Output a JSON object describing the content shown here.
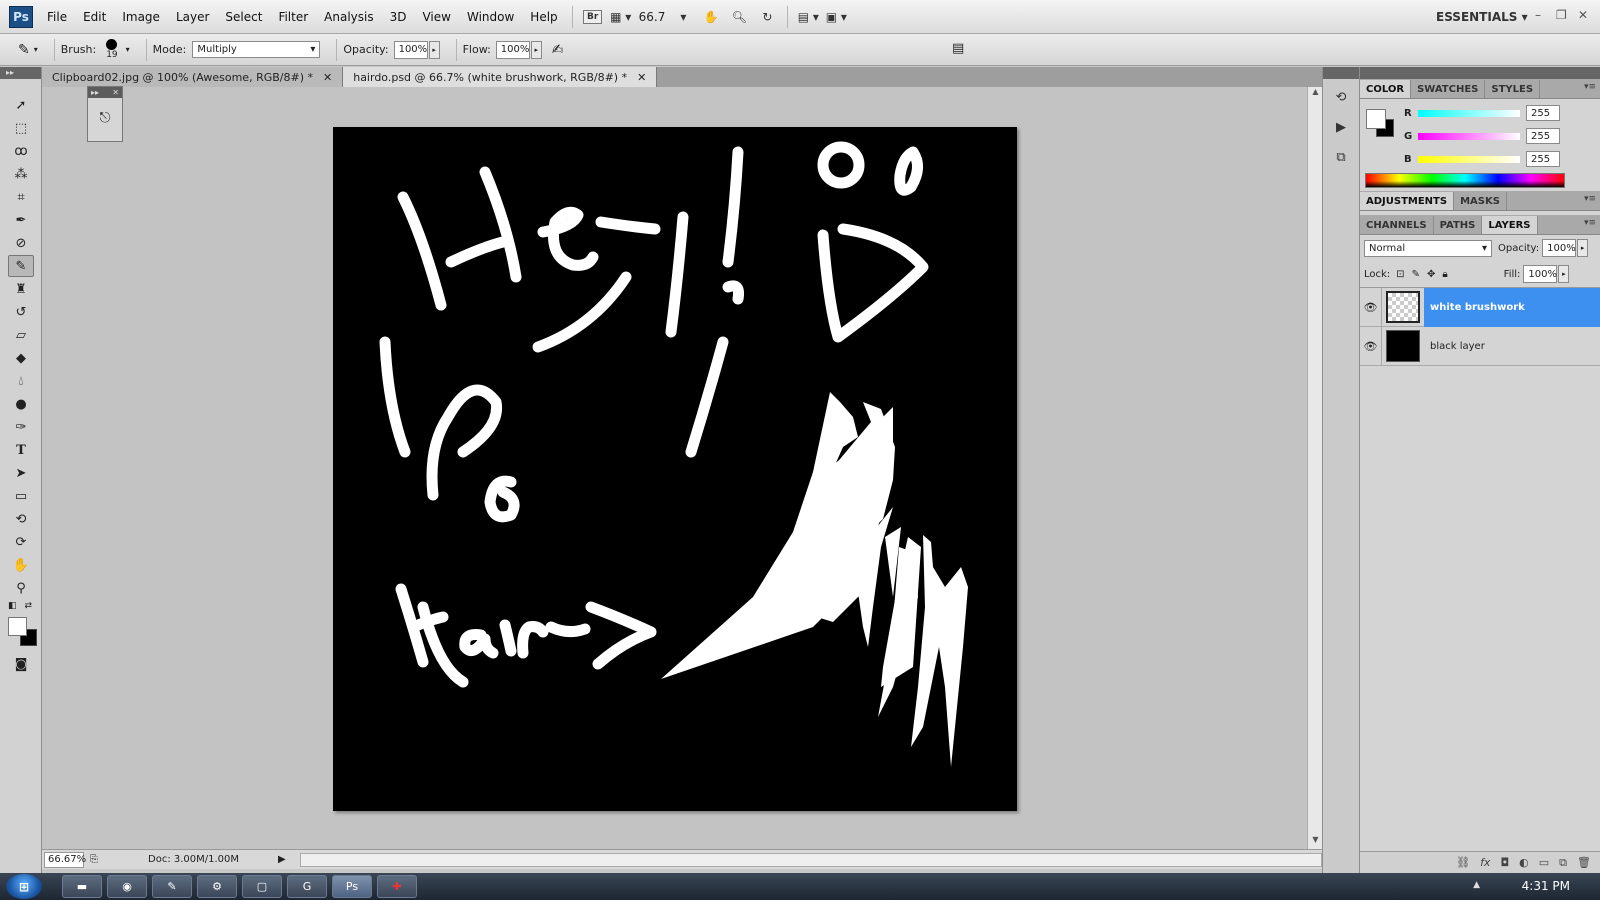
{
  "app": {
    "logo": "Ps"
  },
  "menu": [
    "File",
    "Edit",
    "Image",
    "Layer",
    "Select",
    "Filter",
    "Analysis",
    "3D",
    "View",
    "Window",
    "Help"
  ],
  "menubar_tools": {
    "bridge_label": "Br",
    "zoom_value": "66.7",
    "workspace": "ESSENTIALS"
  },
  "options": {
    "brush_label": "Brush:",
    "brush_size": "19",
    "mode_label": "Mode:",
    "mode_value": "Multiply",
    "opacity_label": "Opacity:",
    "opacity_value": "100%",
    "flow_label": "Flow:",
    "flow_value": "100%"
  },
  "tabs": [
    {
      "label": "Clipboard02.jpg @ 100% (Awesome, RGB/8#) *",
      "active": false
    },
    {
      "label": "hairdo.psd @ 66.7% (white brushwork, RGB/8#) *",
      "active": true
    }
  ],
  "status": {
    "zoom": "66.67%",
    "doc": "Doc: 3.00M/1.00M"
  },
  "color_panel": {
    "tabs": [
      "COLOR",
      "SWATCHES",
      "STYLES"
    ],
    "channels": [
      {
        "label": "R",
        "value": "255",
        "color": "#00ffff"
      },
      {
        "label": "G",
        "value": "255",
        "color": "#ff00ff"
      },
      {
        "label": "B",
        "value": "255",
        "color": "#ffff00"
      }
    ],
    "foreground": "#ffffff",
    "background": "#000000"
  },
  "adjust_panel": {
    "tabs": [
      "ADJUSTMENTS",
      "MASKS"
    ]
  },
  "layers_panel": {
    "tabs": [
      "CHANNELS",
      "PATHS",
      "LAYERS"
    ],
    "blend_mode": "Normal",
    "opacity_label": "Opacity:",
    "opacity_value": "100%",
    "lock_label": "Lock:",
    "fill_label": "Fill:",
    "fill_value": "100%",
    "layers": [
      {
        "name": "white brushwork",
        "selected": true,
        "thumb": "transparent"
      },
      {
        "name": "black layer",
        "selected": false,
        "thumb": "black"
      }
    ]
  },
  "taskbar": {
    "clock": "4:31 PM"
  },
  "colors": {
    "accent_selection": "#3d8ff0",
    "canvas_bg": "#000000",
    "stroke": "#ffffff"
  }
}
